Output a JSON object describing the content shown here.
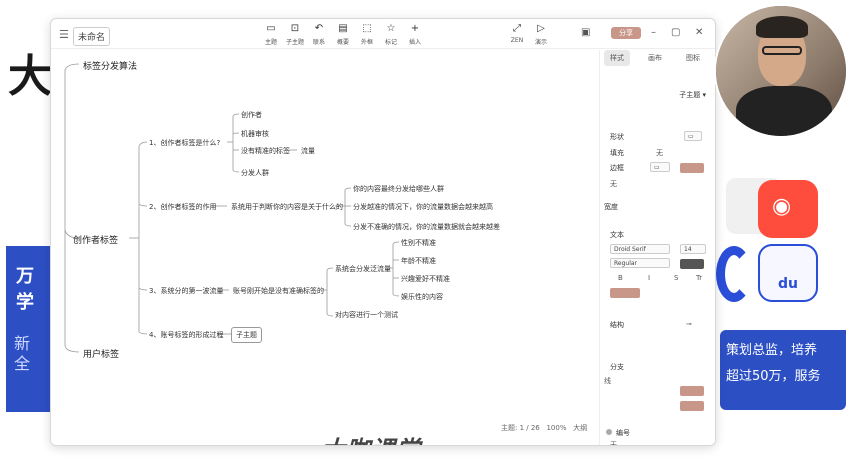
{
  "background": {
    "big_char": "大",
    "blue_block_title": "万学",
    "blue_block_lines": [
      "新",
      "全"
    ],
    "right_text_lines": [
      "策划总监，培养",
      "超过50万，服务"
    ],
    "du_logo": "du"
  },
  "window": {
    "doc_name": "未命名",
    "toolbar": [
      {
        "icon": "▭",
        "label": "主题"
      },
      {
        "icon": "⊡",
        "label": "子主题"
      },
      {
        "icon": "↶",
        "label": "联系"
      },
      {
        "icon": "▤",
        "label": "概要"
      },
      {
        "icon": "⬚",
        "label": "外框"
      },
      {
        "icon": "☆",
        "label": "标记"
      },
      {
        "icon": "+",
        "label": "插入"
      }
    ],
    "right_toolbar": [
      {
        "icon": "⤢",
        "label": "ZEN"
      },
      {
        "icon": "▷",
        "label": "演示"
      }
    ],
    "share_label": "分享",
    "status": {
      "topics": "主题: 1 / 26",
      "zoom": "100%",
      "size": "大纲"
    }
  },
  "mindmap": {
    "root": "标签分发算法",
    "branch_creator": "创作者标签",
    "branch_user": "用户标签",
    "q1": "1、创作者标签是什么?",
    "q1_children": [
      "创作者",
      "机器审核",
      "没有精准的标签",
      "分发人群"
    ],
    "q1_traffic": "流量",
    "q2": "2、创作者标签的作用",
    "q2_desc": "系统用于判断你的内容是关于什么的",
    "q2_children": [
      "你的内容最终分发给哪些人群",
      "分发越准的情况下，你的流量数据会越来越高",
      "分发不准确的情况，你的流量数据就会越来越差"
    ],
    "q3": "3、系统分的第一波流量",
    "q3_desc": "账号刚开始是没有准确标签的",
    "q3_sub1": "系统会分发泛流量",
    "q3_sub1_children": [
      "性别不精准",
      "年龄不精准",
      "兴趣爱好不精准",
      "娱乐性的内容"
    ],
    "q3_sub2": "对内容进行一个测试",
    "q4": "4、账号标签的形成过程",
    "q4_child": "子主题",
    "watermark": "大咖课堂"
  },
  "panel": {
    "tabs": [
      "样式",
      "画布",
      "图标"
    ],
    "subtopic_select": "子主题",
    "shape_label": "形状",
    "fill_label": "填充",
    "fill_value": "无",
    "border_label": "边框",
    "border_value": "无",
    "width_label": "宽度",
    "text_label": "文本",
    "font_name": "Droid Serif",
    "font_size": "14",
    "font_weight": "Regular",
    "text_color": "#555555",
    "structure_label": "结构",
    "branch_label": "分支",
    "numbering_label": "编号",
    "numbering_value": "无",
    "line_label": "线",
    "accent_fill": "#c9978a",
    "accent_text": "#444444"
  },
  "colors": {
    "line": "#9a9a9a",
    "accent": "#c9978a"
  }
}
